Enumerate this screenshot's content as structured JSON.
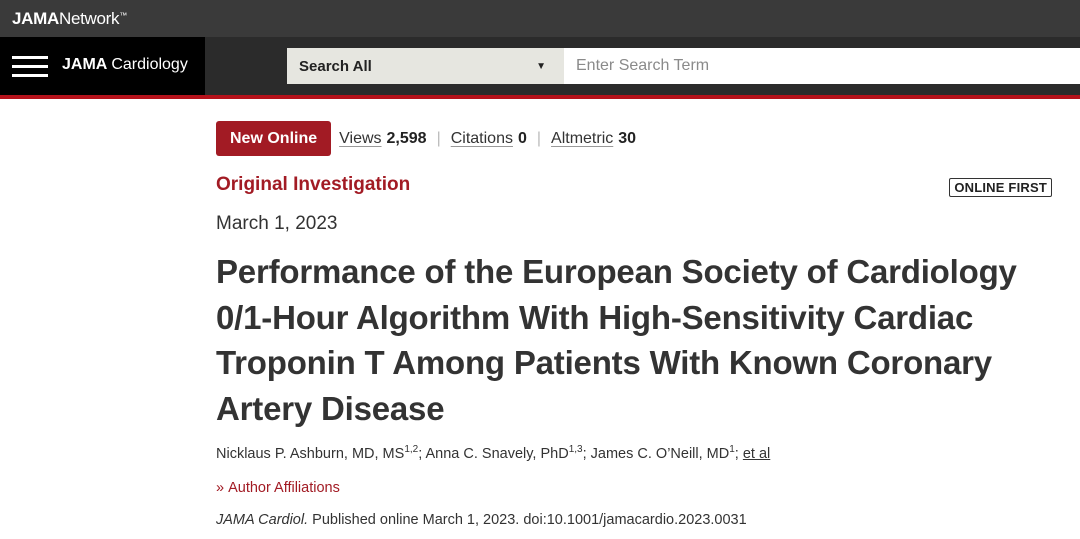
{
  "network": {
    "brand_bold": "JAMA",
    "brand_rest": "Network",
    "tm": "™"
  },
  "journal": {
    "name_bold": "JAMA",
    "name_rest": "Cardiology"
  },
  "search": {
    "scope": "Search All",
    "placeholder": "Enter Search Term"
  },
  "article": {
    "badge": "New Online",
    "metrics": [
      {
        "label": "Views",
        "value": "2,598"
      },
      {
        "label": "Citations",
        "value": "0"
      },
      {
        "label": "Altmetric",
        "value": "30"
      }
    ],
    "type": "Original Investigation",
    "status": "ONLINE FIRST",
    "date": "March 1, 2023",
    "title": "Performance of the European Society of Cardiology 0/1-Hour Algorithm With High-Sensitivity Cardiac Troponin T Among Patients With Known Coronary Artery Disease",
    "authors": [
      {
        "name": "Nicklaus P. Ashburn, MD, MS",
        "sup": "1,2"
      },
      {
        "name": "Anna C. Snavely, PhD",
        "sup": "1,3"
      },
      {
        "name": "James C. O’Neill, MD",
        "sup": "1"
      }
    ],
    "et_al": "et al",
    "affiliations_link": "Author Affiliations",
    "citation_journal": "JAMA Cardiol.",
    "citation_rest": " Published online March 1, 2023. doi:10.1001/jamacardio.2023.0031"
  },
  "colors": {
    "accent": "#a21b24",
    "topbar": "#3a3a3a",
    "journalbar": "#2b2b2b",
    "rule": "#b5121b"
  }
}
